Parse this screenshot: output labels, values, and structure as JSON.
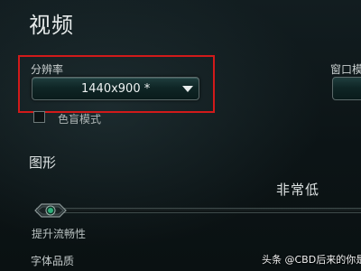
{
  "page": {
    "title": "视频"
  },
  "resolution": {
    "label": "分辨率",
    "value": "1440x900 *"
  },
  "window_mode": {
    "label": "窗口模"
  },
  "colorblind": {
    "label": "色盲模式",
    "checked": false
  },
  "graphics": {
    "title": "图形",
    "quality_value": "非常低",
    "slider_caption": "提升流畅性",
    "slider_level": 0
  },
  "texture": {
    "label": "字体品质"
  },
  "watermark": {
    "text": "头条 @CBD后来的你是"
  },
  "colors": {
    "highlight": "#d11a1a",
    "accent": "#2fae7a"
  }
}
